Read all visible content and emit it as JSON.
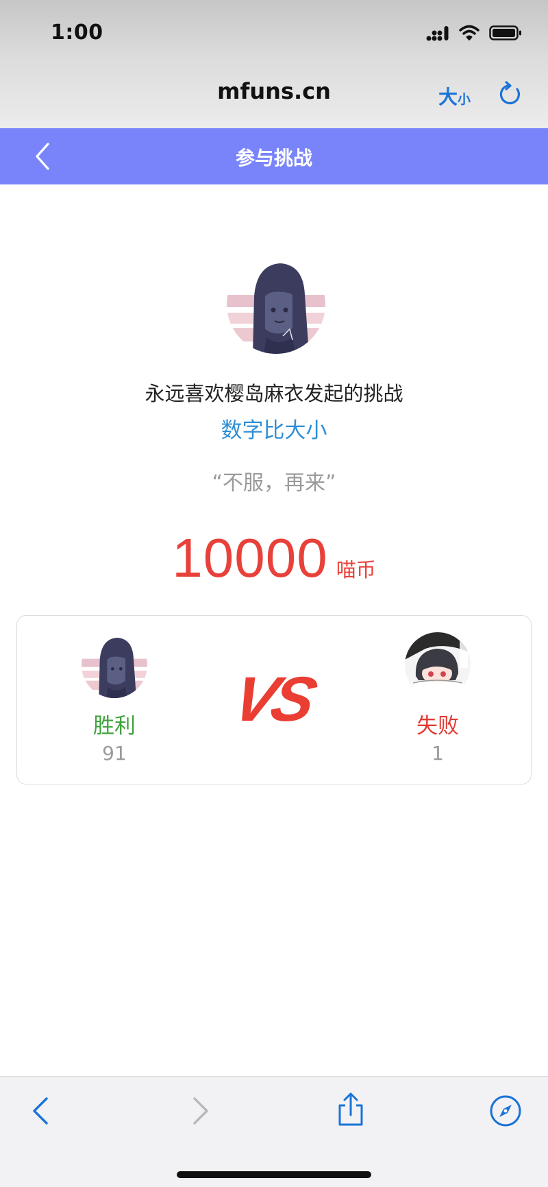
{
  "status_bar": {
    "time": "1:00"
  },
  "browser": {
    "url": "mfuns.cn",
    "text_size_big": "大",
    "text_size_small": "小",
    "accent_color": "#1a73d8"
  },
  "app_nav": {
    "title": "参与挑战",
    "background_color": "#7a84fa"
  },
  "challenge": {
    "host_line": "永远喜欢樱岛麻衣发起的挑战",
    "game_name": "数字比大小",
    "slogan": "“不服，再来”",
    "stake_amount": "10000",
    "stake_unit": "喵币"
  },
  "record": {
    "vs_text": "VS",
    "winner_label": "胜利",
    "winner_count": "91",
    "loser_label": "失败",
    "loser_count": "1"
  },
  "toolbar": {
    "icons": [
      "back-icon",
      "forward-icon",
      "share-icon",
      "compass-icon"
    ]
  }
}
